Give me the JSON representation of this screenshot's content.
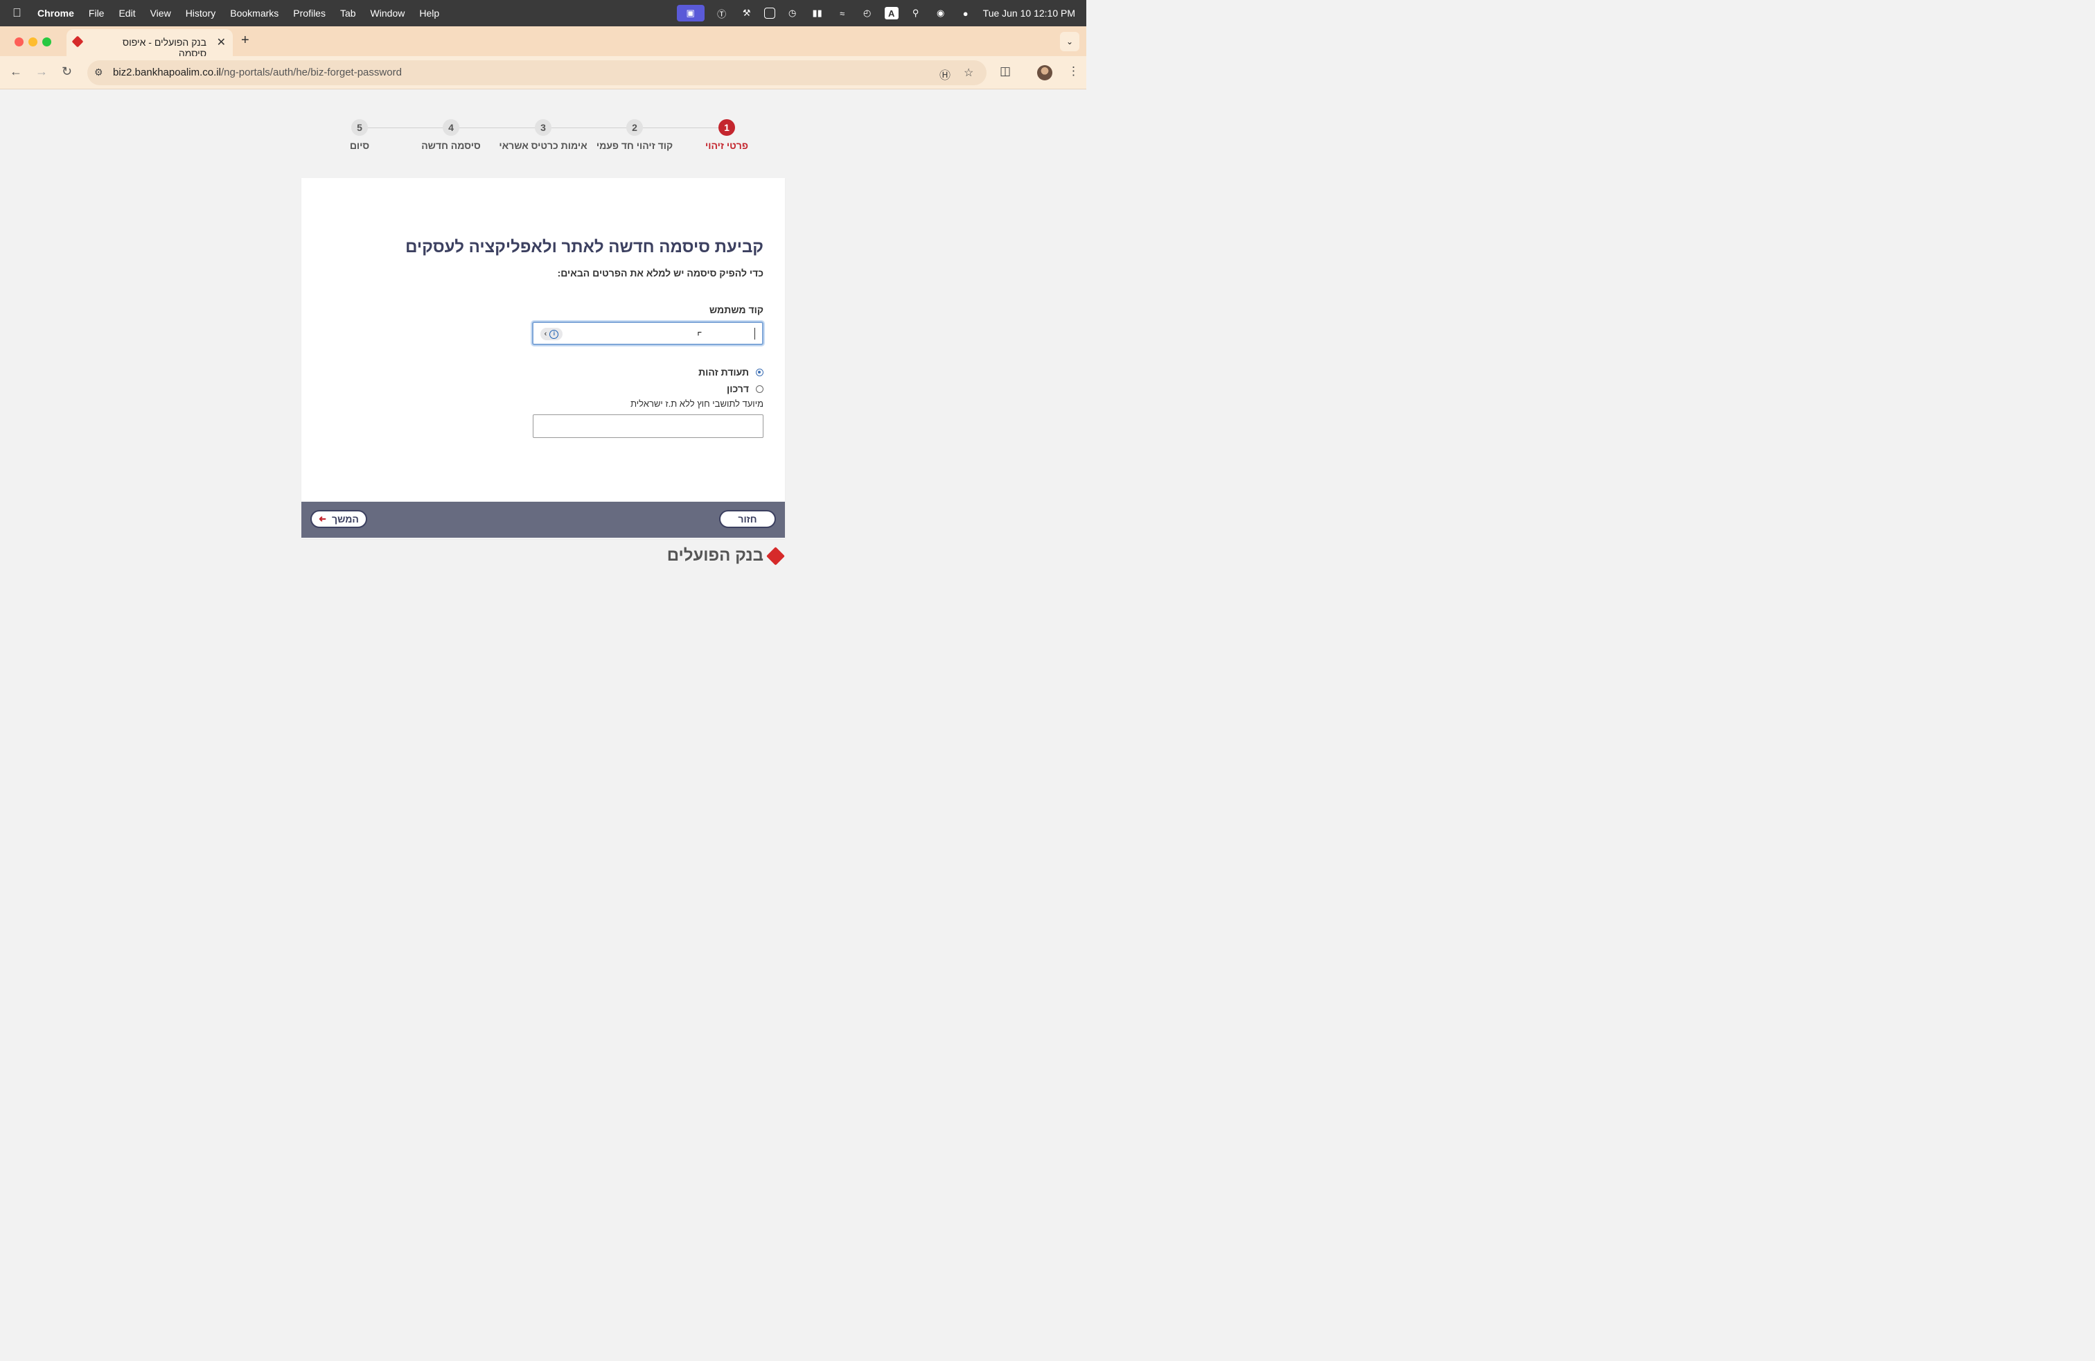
{
  "menubar": {
    "app": "Chrome",
    "items": [
      "File",
      "Edit",
      "View",
      "History",
      "Bookmarks",
      "Profiles",
      "Tab",
      "Window",
      "Help"
    ],
    "datetime": "Tue Jun 10  12:10 PM"
  },
  "tab": {
    "title": "בנק הפועלים - איפוס סיסמה"
  },
  "address_bar": {
    "host": "biz2.bankhapoalim.co.il",
    "path": "/ng-portals/auth/he/biz-forget-password"
  },
  "stepper": {
    "steps": [
      {
        "number": "1",
        "label": "פרטי זיהוי",
        "active": true
      },
      {
        "number": "2",
        "label": "קוד זיהוי חד פעמי",
        "active": false
      },
      {
        "number": "3",
        "label": "אימות כרטיס אשראי",
        "active": false
      },
      {
        "number": "4",
        "label": "סיסמה חדשה",
        "active": false
      },
      {
        "number": "5",
        "label": "סיום",
        "active": false
      }
    ]
  },
  "form": {
    "title": "קביעת סיסמה חדשה לאתר ולאפליקציה לעסקים",
    "subtitle": "כדי להפיק סיסמה יש למלא את הפרטים הבאים:",
    "user_code_label": "קוד משתמש",
    "user_code_value": "",
    "id_type_options": [
      {
        "label": "תעודת זהות",
        "checked": true
      },
      {
        "label": "דרכון",
        "checked": false
      }
    ],
    "passport_hint": "מיועד לתושבי חוץ ללא ת.ז ישראלית",
    "passport_value": ""
  },
  "footer": {
    "back_label": "חזור",
    "next_label": "המשך"
  },
  "brand": {
    "name": "בנק הפועלים"
  },
  "colors": {
    "accent": "#c4262e",
    "footer_bar": "#676b80",
    "title_text": "#3c4060"
  }
}
